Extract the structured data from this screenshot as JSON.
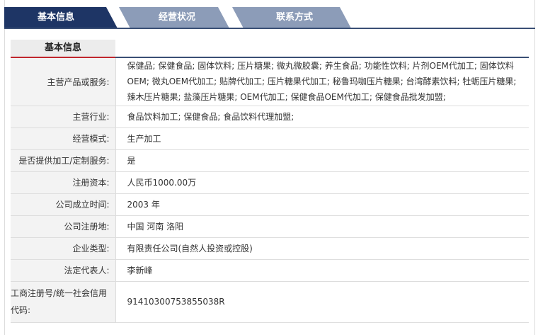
{
  "tabs": [
    {
      "label": "基本信息",
      "active": true
    },
    {
      "label": "经营状况",
      "active": false
    },
    {
      "label": "联系方式",
      "active": false
    }
  ],
  "section": {
    "title": "基本信息"
  },
  "rows": [
    {
      "label": "主营产品或服务:",
      "value": "保健品; 保健食品; 固体饮料; 压片糖果; 微丸微胶囊; 养生食品; 功能性饮料; 片剂OEM代加工; 固体饮料OEM; 微丸OEM代加工; 贴牌代加工; 压片糖果代加工; 秘鲁玛咖压片糖果; 台湾酵素饮料; 牡蛎压片糖果; 辣木压片糖果; 盐藻压片糖果; OEM代加工; 保健食品OEM代加工; 保健食品批发加盟;"
    },
    {
      "label": "主营行业:",
      "value": "食品饮料加工; 保健食品; 食品饮料代理加盟;"
    },
    {
      "label": "经营模式:",
      "value": "生产加工"
    },
    {
      "label": "是否提供加工/定制服务:",
      "value": "是"
    },
    {
      "label": "注册资本:",
      "value": "人民币1000.00万"
    },
    {
      "label": "公司成立时间:",
      "value": "2003 年"
    },
    {
      "label": "公司注册地:",
      "value": "中国 河南 洛阳"
    },
    {
      "label": "企业类型:",
      "value": "有限责任公司(自然人投资或控股)"
    },
    {
      "label": "法定代表人:",
      "value": "李新峰"
    },
    {
      "label": "工商注册号/统一社会信用代码:",
      "value": "91410300753855038R"
    }
  ]
}
